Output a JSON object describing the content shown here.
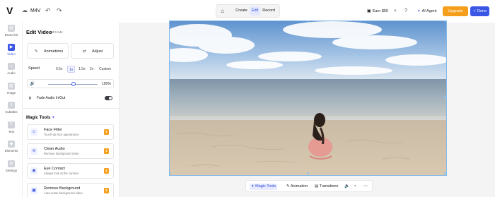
{
  "header": {
    "logo": "V",
    "file_name": "M4V",
    "modes": [
      {
        "label": "Create",
        "active": false
      },
      {
        "label": "Edit",
        "active": true
      },
      {
        "label": "Record",
        "active": false
      }
    ],
    "earn_label": "Earn $50",
    "ai_agent_label": "AI Agent",
    "upgrade_label": "Upgrade",
    "done_label": "Done",
    "accent_color": "#3a56e4",
    "upgrade_color": "#f59e1b"
  },
  "rail": {
    "items": [
      {
        "label": "Brand Kit",
        "icon": "brand-kit-icon",
        "active": false
      },
      {
        "label": "Video",
        "icon": "video-icon",
        "active": true
      },
      {
        "label": "Audio",
        "icon": "audio-icon",
        "active": false
      },
      {
        "label": "Image",
        "icon": "image-icon",
        "active": false
      },
      {
        "label": "Subtitles",
        "icon": "subtitles-icon",
        "active": false
      },
      {
        "label": "Text",
        "icon": "text-icon",
        "active": false
      },
      {
        "label": "Elements",
        "icon": "elements-icon",
        "active": false
      },
      {
        "label": "Settings",
        "icon": "settings-icon",
        "active": false
      }
    ]
  },
  "panel": {
    "title": "Edit Video",
    "subtitle": "M4V.m4v",
    "animations_label": "Animations",
    "adjust_label": "Adjust",
    "speed_label": "Speed",
    "speed_options": [
      "0.5x",
      "1x",
      "1.5x",
      "2x",
      "Custom"
    ],
    "speed_selected": "1x",
    "volume_value": "100%",
    "volume_level": 0.5,
    "fade_label": "Fade Audio In/Out",
    "fade_enabled": true,
    "magic_tools_title": "Magic Tools",
    "tools": [
      {
        "name": "Face Filter",
        "desc": "Touch-up face appearance",
        "icon": "face-filter-icon"
      },
      {
        "name": "Clean Audio",
        "desc": "Remove background noise",
        "icon": "clean-audio-icon"
      },
      {
        "name": "Eye Contact",
        "desc": "Always look at the camera",
        "icon": "eye-contact-icon"
      },
      {
        "name": "Remove Background",
        "desc": "Auto-erase background video",
        "icon": "remove-background-icon"
      }
    ],
    "tool_badge": "$"
  },
  "bottombar": {
    "magic_tools_label": "Magic Tools",
    "animation_label": "Animation",
    "transitions_label": "Transitions"
  }
}
